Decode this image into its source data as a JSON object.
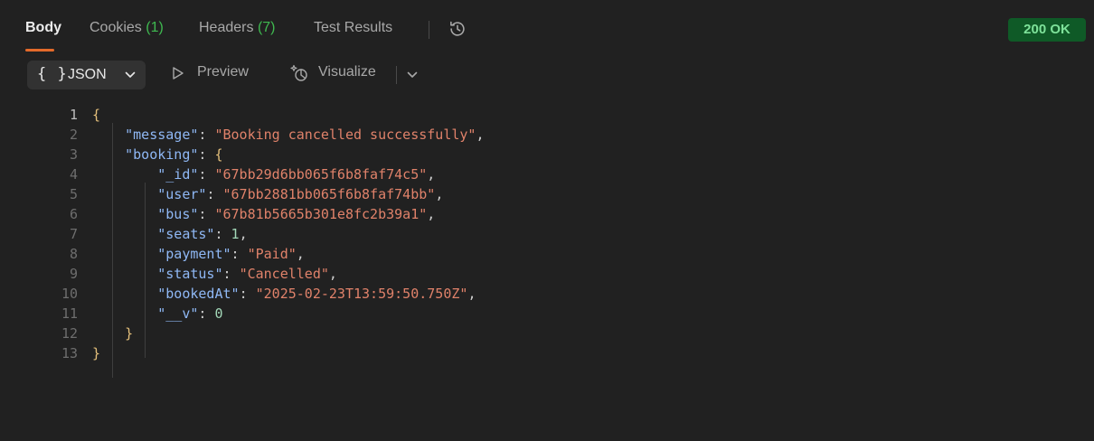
{
  "tabs": [
    {
      "label": "Body",
      "count": "",
      "active": true
    },
    {
      "label": "Cookies",
      "count": "(1)",
      "active": false
    },
    {
      "label": "Headers",
      "count": "(7)",
      "active": false
    },
    {
      "label": "Test Results",
      "count": "",
      "active": false
    }
  ],
  "status": {
    "text": "200 OK",
    "color": "#0f5a27"
  },
  "toolbar": {
    "format_braces": "{ }",
    "format_label": "JSON",
    "preview_label": "Preview",
    "visualize_label": "Visualize"
  },
  "icons": {
    "history": "history-icon",
    "format_dropdown": "chevron-down-icon",
    "preview": "play-outline-icon",
    "visualize": "sparkle-visualize-icon",
    "visualize_dropdown": "chevron-down-icon"
  },
  "code": {
    "lines": [
      {
        "num": "1",
        "indent": "",
        "parts": [
          [
            "b",
            "{"
          ]
        ]
      },
      {
        "num": "2",
        "indent": "    ",
        "parts": [
          [
            "k",
            "\"message\""
          ],
          [
            "p",
            ": "
          ],
          [
            "s",
            "\"Booking cancelled successfully\""
          ],
          [
            "p",
            ","
          ]
        ]
      },
      {
        "num": "3",
        "indent": "    ",
        "parts": [
          [
            "k",
            "\"booking\""
          ],
          [
            "p",
            ": "
          ],
          [
            "b",
            "{"
          ]
        ]
      },
      {
        "num": "4",
        "indent": "        ",
        "parts": [
          [
            "k",
            "\"_id\""
          ],
          [
            "p",
            ": "
          ],
          [
            "s",
            "\"67bb29d6bb065f6b8faf74c5\""
          ],
          [
            "p",
            ","
          ]
        ]
      },
      {
        "num": "5",
        "indent": "        ",
        "parts": [
          [
            "k",
            "\"user\""
          ],
          [
            "p",
            ": "
          ],
          [
            "s",
            "\"67bb2881bb065f6b8faf74bb\""
          ],
          [
            "p",
            ","
          ]
        ]
      },
      {
        "num": "6",
        "indent": "        ",
        "parts": [
          [
            "k",
            "\"bus\""
          ],
          [
            "p",
            ": "
          ],
          [
            "s",
            "\"67b81b5665b301e8fc2b39a1\""
          ],
          [
            "p",
            ","
          ]
        ]
      },
      {
        "num": "7",
        "indent": "        ",
        "parts": [
          [
            "k",
            "\"seats\""
          ],
          [
            "p",
            ": "
          ],
          [
            "n",
            "1"
          ],
          [
            "p",
            ","
          ]
        ]
      },
      {
        "num": "8",
        "indent": "        ",
        "parts": [
          [
            "k",
            "\"payment\""
          ],
          [
            "p",
            ": "
          ],
          [
            "s",
            "\"Paid\""
          ],
          [
            "p",
            ","
          ]
        ]
      },
      {
        "num": "9",
        "indent": "        ",
        "parts": [
          [
            "k",
            "\"status\""
          ],
          [
            "p",
            ": "
          ],
          [
            "s",
            "\"Cancelled\""
          ],
          [
            "p",
            ","
          ]
        ]
      },
      {
        "num": "10",
        "indent": "        ",
        "parts": [
          [
            "k",
            "\"bookedAt\""
          ],
          [
            "p",
            ": "
          ],
          [
            "s",
            "\"2025-02-23T13:59:50.750Z\""
          ],
          [
            "p",
            ","
          ]
        ]
      },
      {
        "num": "11",
        "indent": "        ",
        "parts": [
          [
            "k",
            "\"__v\""
          ],
          [
            "p",
            ": "
          ],
          [
            "n",
            "0"
          ]
        ]
      },
      {
        "num": "12",
        "indent": "    ",
        "parts": [
          [
            "b",
            "}"
          ]
        ]
      },
      {
        "num": "13",
        "indent": "",
        "parts": [
          [
            "b",
            "}"
          ]
        ]
      }
    ]
  }
}
